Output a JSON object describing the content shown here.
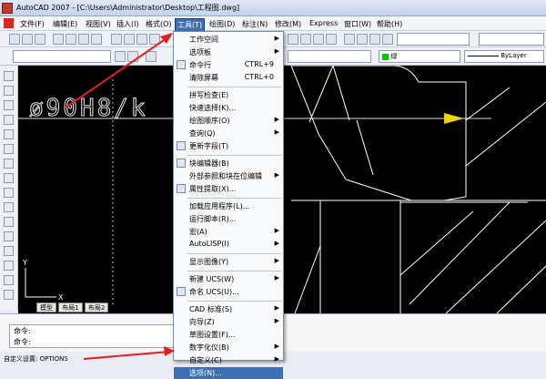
{
  "window": {
    "title": "AutoCAD 2007 - [C:\\Users\\Administrator\\Desktop\\工程图.dwg]"
  },
  "menubar": [
    {
      "label": "文件(F)"
    },
    {
      "label": "编辑(E)"
    },
    {
      "label": "视图(V)"
    },
    {
      "label": "插入(I)"
    },
    {
      "label": "格式(O)"
    },
    {
      "label": "工具(T)"
    },
    {
      "label": "绘图(D)"
    },
    {
      "label": "标注(N)"
    },
    {
      "label": "修改(M)"
    },
    {
      "label": "Express"
    },
    {
      "label": "窗口(W)"
    },
    {
      "label": "帮助(H)"
    }
  ],
  "toolbar": {
    "color_combo": "绿",
    "linetype_combo": "ByLayer"
  },
  "tools_menu": [
    {
      "label": "工作空间",
      "arrow": "▶"
    },
    {
      "label": "选项板",
      "arrow": "▶"
    },
    {
      "label": "命令行",
      "shortcut": "CTRL+9",
      "icon": true
    },
    {
      "label": "清除屏幕",
      "shortcut": "CTRL+0"
    },
    {
      "label": "拼写检查(E)",
      "sep_before": true
    },
    {
      "label": "快速选择(K)..."
    },
    {
      "label": "绘图顺序(O)",
      "arrow": "▶"
    },
    {
      "label": "查询(Q)",
      "arrow": "▶"
    },
    {
      "label": "更新字段(T)",
      "icon": true
    },
    {
      "label": "块编辑器(B)",
      "sep_before": true,
      "icon": true
    },
    {
      "label": "外部参照和块在位编辑",
      "arrow": "▶"
    },
    {
      "label": "属性提取(X)...",
      "icon": true
    },
    {
      "label": "加载应用程序(L)...",
      "sep_before": true
    },
    {
      "label": "运行脚本(R)..."
    },
    {
      "label": "宏(A)",
      "arrow": "▶"
    },
    {
      "label": "AutoLISP(I)",
      "arrow": "▶"
    },
    {
      "label": "显示图像(Y)",
      "sep_before": true,
      "arrow": "▶"
    },
    {
      "label": "新建 UCS(W)",
      "sep_before": true,
      "arrow": "▶"
    },
    {
      "label": "命名 UCS(U)...",
      "icon": true
    },
    {
      "label": "CAD 标准(S)",
      "sep_before": true,
      "arrow": "▶"
    },
    {
      "label": "向导(Z)",
      "arrow": "▶"
    },
    {
      "label": "草图设置(F)..."
    },
    {
      "label": "数字化仪(B)",
      "arrow": "▶"
    },
    {
      "label": "自定义(C)",
      "arrow": "▶"
    },
    {
      "label": "选项(N)...",
      "highlighted": true
    }
  ],
  "drawing": {
    "dimension_text": "ø90H8/k"
  },
  "layout_tabs": [
    "模型",
    "布局1",
    "布局2"
  ],
  "command": {
    "line1": "命令:",
    "line2": "命令:"
  },
  "status": {
    "text": "自定义设置:   OPTIONS"
  },
  "colors": {
    "menu_highlight": "#3c6fb4",
    "arrow_red": "#e02020",
    "ucs_yellow": "#f2d200"
  }
}
